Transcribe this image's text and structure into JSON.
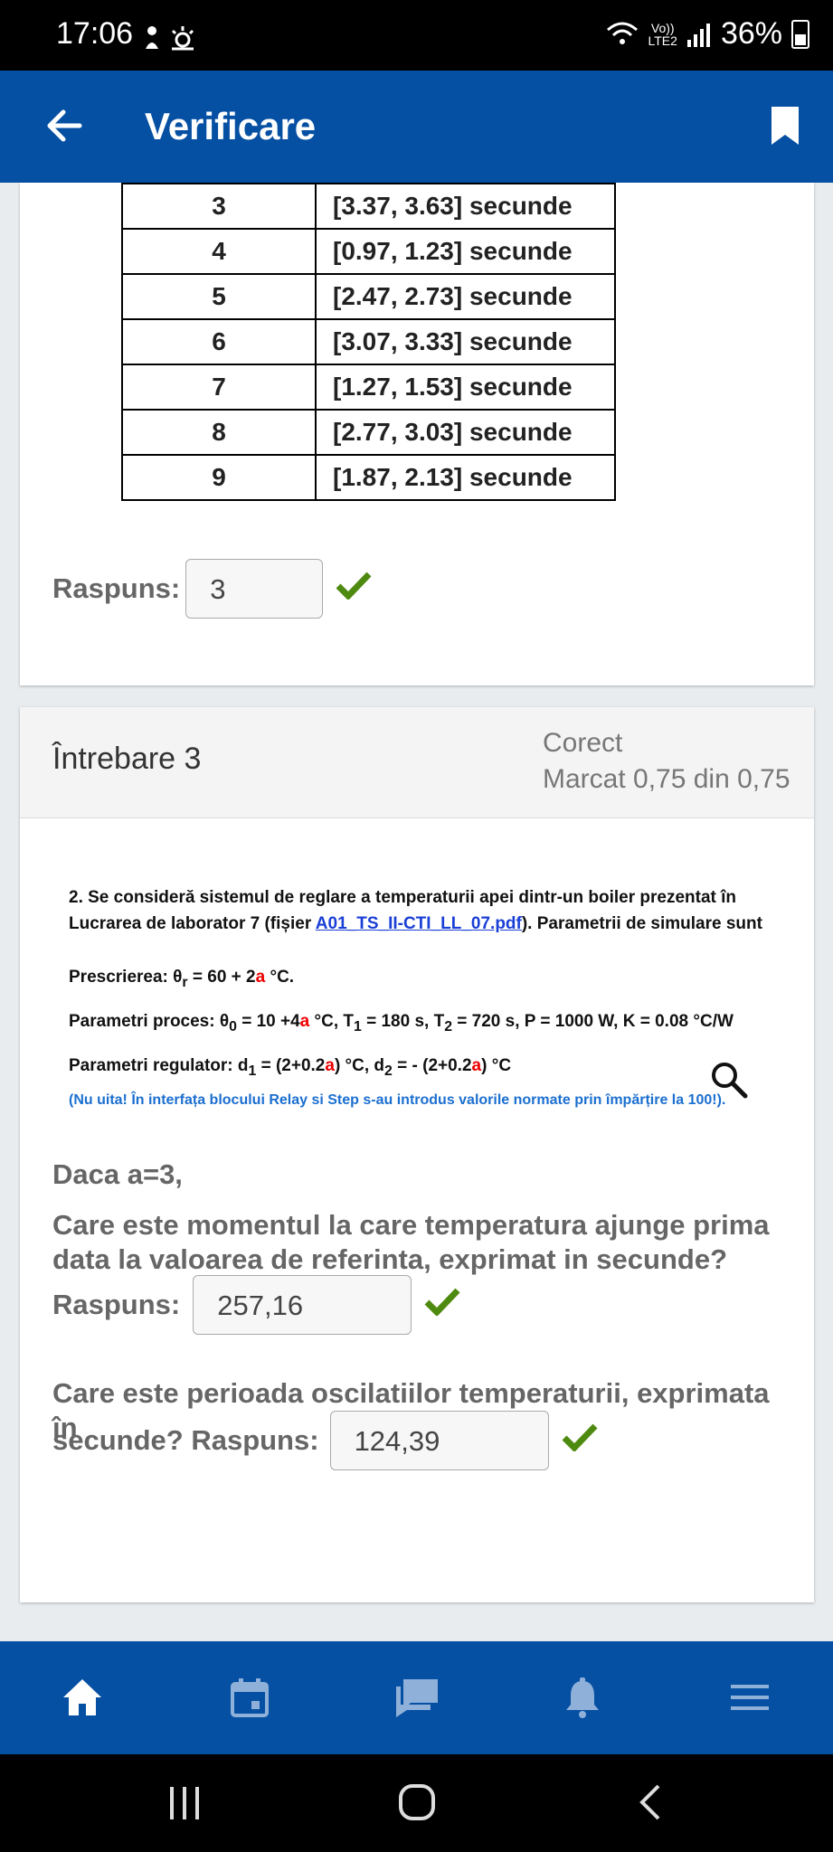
{
  "status_bar": {
    "time": "17:06",
    "network_top": "Vo))",
    "network_bottom": "LTE2",
    "battery": "36%"
  },
  "app_bar": {
    "title": "Verificare"
  },
  "table": {
    "rows": [
      {
        "num": "3",
        "interval": "[3.37, 3.63]  secunde"
      },
      {
        "num": "4",
        "interval": "[0.97, 1.23] secunde"
      },
      {
        "num": "5",
        "interval": "[2.47, 2.73] secunde"
      },
      {
        "num": "6",
        "interval": "[3.07, 3.33] secunde"
      },
      {
        "num": "7",
        "interval": "[1.27, 1.53] secunde"
      },
      {
        "num": "8",
        "interval": "[2.77, 3.03] secunde"
      },
      {
        "num": "9",
        "interval": "[1.87, 2.13] secunde"
      }
    ]
  },
  "q2_answer": {
    "label": "Raspuns:",
    "value": "3"
  },
  "question3": {
    "title": "Întrebare 3",
    "status": "Corect",
    "mark": "Marcat 0,75 din 0,75",
    "problem": {
      "line1": "2. Se consideră sistemul de reglare a temperaturii apei dintr-un boiler prezentat în",
      "line2_a": "Lucrarea de laborator 7 (fișier ",
      "link": "A01_TS_II-CTI_LL_07.pdf",
      "line2_b": ").  Parametrii de simulare sunt",
      "presc_a": "Prescrierea: θ",
      "presc_sub": "r",
      "presc_b": " = 60 + 2",
      "presc_red": "a",
      "presc_c": "  °C.",
      "proc_a": "Parametri proces: θ",
      "proc_sub0": "0",
      "proc_b": " = 10 +4",
      "proc_red": "a",
      "proc_c": " °C, T",
      "proc_sub1": "1",
      "proc_d": " = 180 s, T",
      "proc_sub2": "2",
      "proc_e": " = 720 s, P = 1000 W, K = 0.08 °C/W",
      "reg_a": "Parametri regulator: d",
      "reg_sub1": "1",
      "reg_b": " = (2+0.2",
      "reg_red1": "a",
      "reg_c": ") °C, d",
      "reg_sub2": "2",
      "reg_d": " = - (2+0.2",
      "reg_red2": "a",
      "reg_e": ") °C",
      "note": "(Nu uita! În interfața blocului Relay si Step s-au introdus valorile normate prin împărțire la 100!)."
    },
    "given": "Daca a=3,",
    "q1": "Care este momentul la care temperatura ajunge prima data la valoarea de referinta, exprimat in secunde?",
    "q1_label": "Raspuns:",
    "q1_value": "257,16",
    "q2_line1": "Care este perioada oscilatiilor temperaturii, exprimata în",
    "q2_line2": "secunde? Raspuns:",
    "q2_value": "124,39"
  },
  "colors": {
    "brand": "#0550a3",
    "check": "#4f8a10",
    "red": "#e00000"
  },
  "icons": [
    "back-arrow-icon",
    "bookmark-icon",
    "check-icon",
    "magnifier-icon",
    "home-icon",
    "calendar-icon",
    "messages-icon",
    "bell-icon",
    "menu-icon"
  ]
}
